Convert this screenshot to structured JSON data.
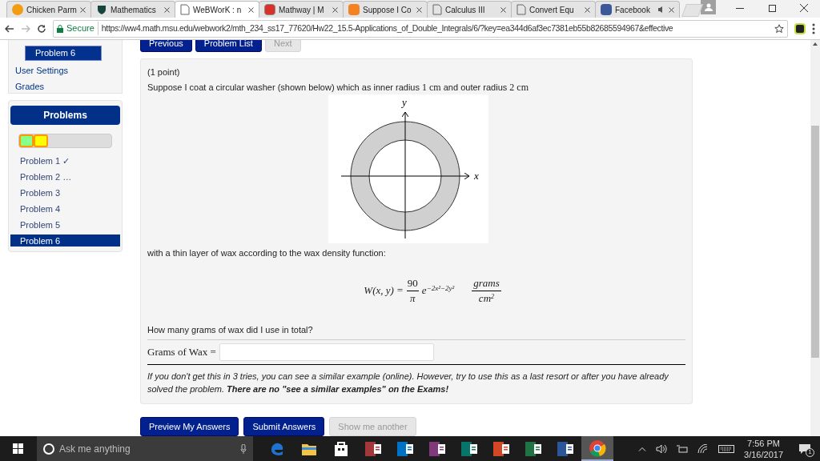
{
  "browser": {
    "tabs": [
      {
        "title": "Chicken Parm",
        "kind": "orange-circle",
        "selected": false,
        "audio": false
      },
      {
        "title": "Mathematics",
        "kind": "shield",
        "selected": false,
        "audio": false
      },
      {
        "title": "WeBWorK : n",
        "kind": "page",
        "selected": true,
        "audio": false
      },
      {
        "title": "Mathway | M",
        "kind": "red-square",
        "selected": false,
        "audio": false
      },
      {
        "title": "Suppose I Co",
        "kind": "orange-square",
        "selected": false,
        "audio": false
      },
      {
        "title": "Calculus III",
        "kind": "page",
        "selected": false,
        "audio": false
      },
      {
        "title": "Convert Equ",
        "kind": "page",
        "selected": false,
        "audio": false
      },
      {
        "title": "Facebook",
        "kind": "blue-square",
        "selected": false,
        "audio": true
      }
    ],
    "secure_label": "Secure",
    "url": "https://ww4.math.msu.edu/webwork2/mth_234_ss17_77620/Hw22_15.5-Applications_of_Double_Integrals/6/?key=ea344d6af3ec7381eb55b82685594967&effective"
  },
  "sidebar": {
    "current_problem": "Problem 6",
    "links": [
      "User Settings",
      "Grades"
    ],
    "problems_title": "Problems",
    "progress": [
      {
        "color": "#88ff88"
      },
      {
        "color": "#ffff00"
      }
    ],
    "problems": [
      {
        "label": "Problem 1 ✓",
        "selected": false
      },
      {
        "label": "Problem 2 …",
        "selected": false
      },
      {
        "label": "Problem 3",
        "selected": false
      },
      {
        "label": "Problem 4",
        "selected": false
      },
      {
        "label": "Problem 5",
        "selected": false
      },
      {
        "label": "Problem 6",
        "selected": true
      }
    ]
  },
  "nav": [
    {
      "label": "Previous",
      "disabled": false
    },
    {
      "label": "Problem List",
      "disabled": false
    },
    {
      "label": "Next",
      "disabled": true
    }
  ],
  "problem": {
    "points": "(1 point)",
    "intro": "Suppose I coat a circular washer (shown below) which as inner radius",
    "inner": "1 cm",
    "and": "and outer radius",
    "outer": "2 cm",
    "figure": {
      "y_label": "y",
      "x_label": "x"
    },
    "after": "with a thin layer of wax according to the wax density function:",
    "formula": {
      "lhs": "W(x, y) =",
      "numerator": "90",
      "denominator": "π",
      "base": "e",
      "exponent": "−2x²−2y²",
      "unit_numerator": "grams",
      "unit_denominator": "cm",
      "unit_power": "2"
    },
    "question": "How many grams of wax did I use in total?",
    "answer_label": "Grams of Wax =",
    "note": "If you don't get this in 3 tries, you can see a similar example (online). However, try to use this as a last resort or after you have already solved the problem. **There are no \"see a similar examples\" on the Exams!**"
  },
  "actions": [
    {
      "label": "Preview My Answers",
      "disabled": false
    },
    {
      "label": "Submit Answers",
      "disabled": false
    },
    {
      "label": "Show me another",
      "disabled": true
    }
  ],
  "taskbar": {
    "search_placeholder": "Ask me anything",
    "apps": [
      {
        "kind": "edge",
        "color": "#1e73d0",
        "selected": false
      },
      {
        "kind": "folder",
        "color": "#f5c342",
        "selected": false
      },
      {
        "kind": "store",
        "color": "#ffffff",
        "selected": false
      },
      {
        "kind": "tile",
        "color": "#a4373a",
        "selected": false
      },
      {
        "kind": "tile",
        "color": "#0072c6",
        "selected": false
      },
      {
        "kind": "tile",
        "color": "#80397b",
        "selected": false
      },
      {
        "kind": "tile",
        "color": "#077568",
        "selected": false
      },
      {
        "kind": "tile",
        "color": "#d24726",
        "selected": false
      },
      {
        "kind": "tile",
        "color": "#217346",
        "selected": false
      },
      {
        "kind": "tile",
        "color": "#2b579a",
        "selected": false
      },
      {
        "kind": "chrome",
        "color": "#db4437",
        "selected": true
      }
    ],
    "time": "7:56 PM",
    "date": "3/16/2017",
    "notifications": "1"
  }
}
